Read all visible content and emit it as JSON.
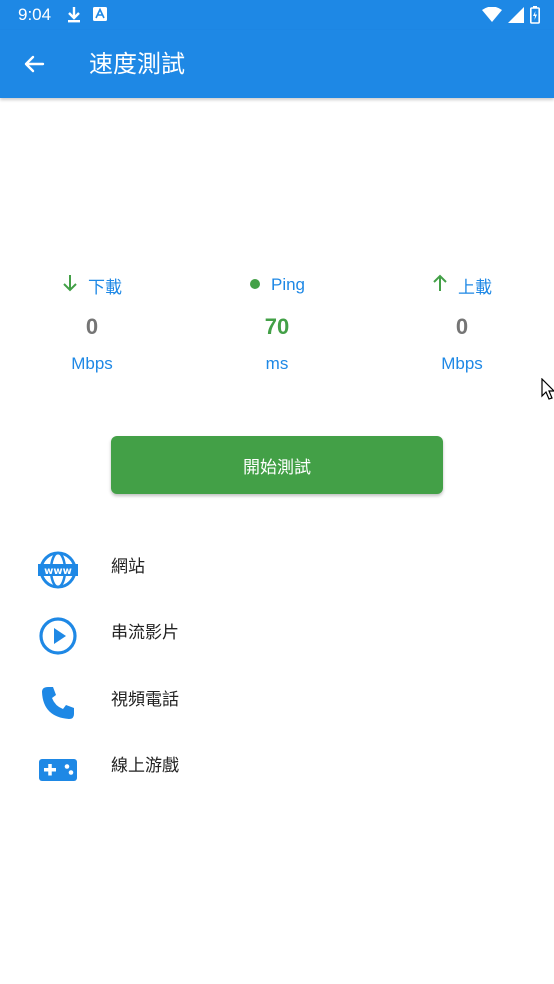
{
  "status_bar": {
    "time": "9:04",
    "icons_left": [
      "download-icon",
      "a-box-icon"
    ],
    "icons_right": [
      "wifi-icon",
      "signal-icon",
      "battery-icon"
    ]
  },
  "appbar": {
    "title": "速度測試",
    "back_icon": "back-arrow-icon",
    "color": "#1e88e5"
  },
  "metrics": [
    {
      "key": "download",
      "label": "下載",
      "value": "0",
      "unit": "Mbps",
      "icon": "arrow-down-icon"
    },
    {
      "key": "ping",
      "label": "Ping",
      "value": "70",
      "unit": "ms",
      "icon": "dot-icon"
    },
    {
      "key": "upload",
      "label": "上載",
      "value": "0",
      "unit": "Mbps",
      "icon": "arrow-up-icon"
    }
  ],
  "start_button": {
    "label": "開始測試",
    "color": "#43a047"
  },
  "list": [
    {
      "label": "網站",
      "icon": "www-icon"
    },
    {
      "label": "串流影片",
      "icon": "play-circle-icon"
    },
    {
      "label": "視頻電話",
      "icon": "phone-icon"
    },
    {
      "label": "線上游戲",
      "icon": "gamepad-icon"
    }
  ],
  "colors": {
    "primary": "#1e88e5",
    "accent_green": "#43a047",
    "value_gray": "#757575"
  }
}
